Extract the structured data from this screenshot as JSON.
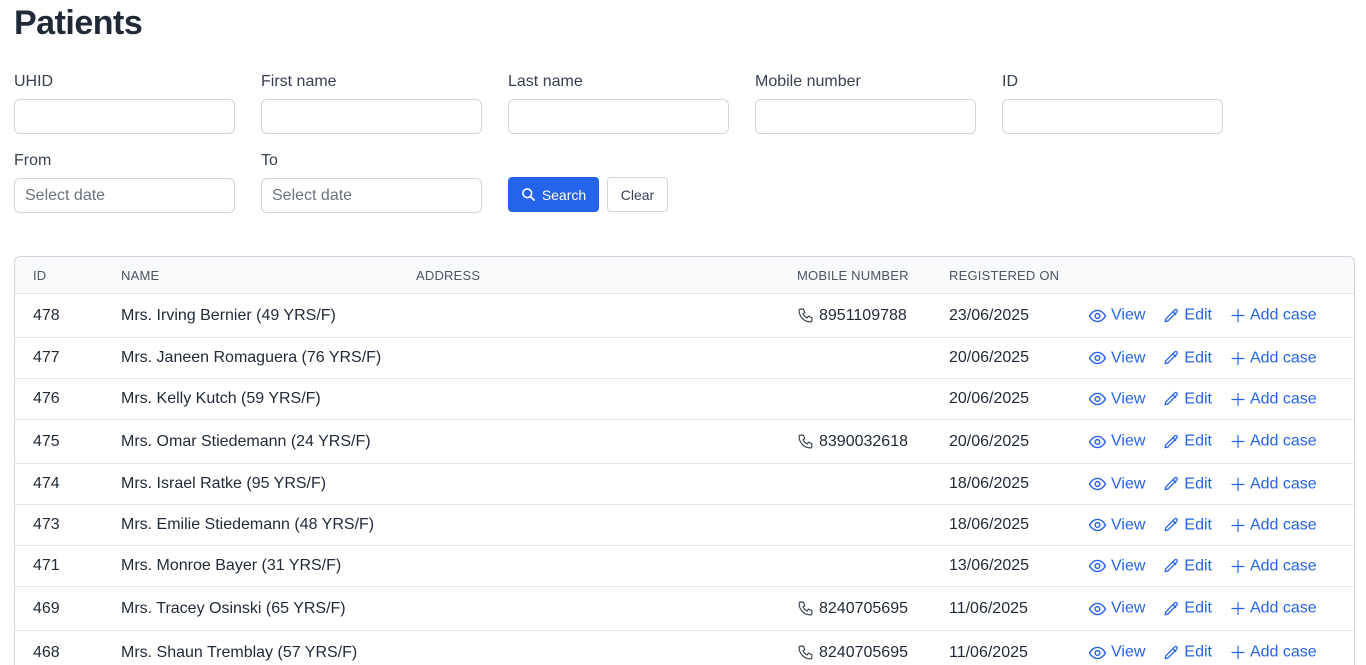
{
  "page": {
    "title": "Patients"
  },
  "filters": {
    "uhid": {
      "label": "UHID",
      "value": "",
      "placeholder": ""
    },
    "first_name": {
      "label": "First name",
      "value": "",
      "placeholder": ""
    },
    "last_name": {
      "label": "Last name",
      "value": "",
      "placeholder": ""
    },
    "mobile": {
      "label": "Mobile number",
      "value": "",
      "placeholder": ""
    },
    "id": {
      "label": "ID",
      "value": "",
      "placeholder": ""
    },
    "from": {
      "label": "From",
      "value": "",
      "placeholder": "Select date"
    },
    "to": {
      "label": "To",
      "value": "",
      "placeholder": "Select date"
    },
    "search_label": "Search",
    "clear_label": "Clear"
  },
  "table": {
    "columns": {
      "id": "ID",
      "name": "NAME",
      "address": "ADDRESS",
      "mobile": "MOBILE NUMBER",
      "registered": "REGISTERED ON"
    },
    "actions": {
      "view": "View",
      "edit": "Edit",
      "add_case": "Add case"
    },
    "rows": [
      {
        "id": "478",
        "name": "Mrs. Irving Bernier (49 YRS/F)",
        "address": "",
        "mobile": "8951109788",
        "registered": "23/06/2025"
      },
      {
        "id": "477",
        "name": "Mrs. Janeen Romaguera (76 YRS/F)",
        "address": "",
        "mobile": "",
        "registered": "20/06/2025"
      },
      {
        "id": "476",
        "name": "Mrs. Kelly Kutch (59 YRS/F)",
        "address": "",
        "mobile": "",
        "registered": "20/06/2025"
      },
      {
        "id": "475",
        "name": "Mrs. Omar Stiedemann (24 YRS/F)",
        "address": "",
        "mobile": "8390032618",
        "registered": "20/06/2025"
      },
      {
        "id": "474",
        "name": "Mrs. Israel Ratke (95 YRS/F)",
        "address": "",
        "mobile": "",
        "registered": "18/06/2025"
      },
      {
        "id": "473",
        "name": "Mrs. Emilie Stiedemann (48 YRS/F)",
        "address": "",
        "mobile": "",
        "registered": "18/06/2025"
      },
      {
        "id": "471",
        "name": "Mrs. Monroe Bayer (31 YRS/F)",
        "address": "",
        "mobile": "",
        "registered": "13/06/2025"
      },
      {
        "id": "469",
        "name": "Mrs. Tracey Osinski (65 YRS/F)",
        "address": "",
        "mobile": "8240705695",
        "registered": "11/06/2025"
      },
      {
        "id": "468",
        "name": "Mrs. Shaun Tremblay (57 YRS/F)",
        "address": "",
        "mobile": "8240705695",
        "registered": "11/06/2025"
      }
    ]
  },
  "icons": {
    "search": "search-icon",
    "view": "eye-icon",
    "edit": "pencil-icon",
    "add": "plus-icon",
    "phone": "phone-icon"
  },
  "colors": {
    "primary": "#2563eb",
    "text": "#1f2937",
    "border": "#d1d5db",
    "header_bg": "#f9fafb"
  }
}
